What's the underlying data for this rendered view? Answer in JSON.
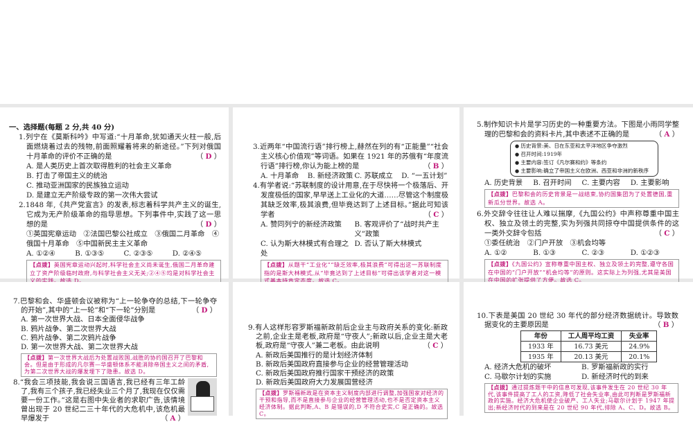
{
  "section_heading": "一、选择题(每题 2 分,共 40 分)",
  "panels": [
    {
      "questions": [
        {
          "num": "1.",
          "stem": "列宁在《莫斯科吟》中写道:“十月革命,犹如通天火柱一般,后面燃烧着过去的残物,前面照耀着将来的新途径。”下列对俄国十月革命的评价不正确的是",
          "answer": "D",
          "options": [
            "A. 是人类历史上首次取得胜利的社会主义革命",
            "B. 打击了帝国主义的统治",
            "C. 推动亚洲国家的民族独立运动",
            "D. 是建立无产阶级专政的第一次伟大尝试"
          ]
        },
        {
          "num": "2.",
          "stem": "1848 年,《共产党宣言》的发表,标志着科学共产主义的诞生,它成为无产阶级革命的指导思想。下列事件中,实践了这一思想的是",
          "answer": "D",
          "extra": "①英国宪章运动　②法国巴黎公社成立　③俄国二月革命　④俄国十月革命　⑤中国新民主主义革命",
          "options": [
            "A. ①②④",
            "B. ①③⑤",
            "C. ②③⑤",
            "D. ②④⑤"
          ],
          "note_label": "【点拨】",
          "note": "英国宪章运动兴起时,科学社会主义尚未诞生,俄国二月革命建立了资产阶级临时政府,与科学社会主义无关;②④⑤均是对科学社会主义的实践。故选 D。"
        }
      ]
    },
    {
      "questions": [
        {
          "num": "3.",
          "stem": "近两年“中国流行语”排行榜上,赫然在列的有“正能量”“社会主义核心价值观”等词语。如果在 1921 年的苏俄有“年度流行语”排行榜,你认为能上榜的是",
          "answer": "B",
          "options": [
            "A. 十月革命",
            "B. 新经济政策",
            "C. 苏联成立",
            "D. “一五计划”"
          ]
        },
        {
          "num": "4.",
          "stem": "有学者说:“苏联制度的设计用意,在于尽快将一个极落后、开发度极低的国家,早早送上工业化的大道……尽管这个制度极其缺乏效率,极其浪费,但毕竟达到了上述目标。”据此可知该学者",
          "answer": "C",
          "options": [
            "A. 赞同列宁的新经济政策",
            "B. 客观评价了“战时共产主义”政策",
            "C. 认为斯大林模式有合理之处",
            "D. 否认了斯大林模式"
          ],
          "note_label": "【点拨】",
          "note": "从题干“工业化”“缺乏效率,极其浪费”可得出这一苏联制度指的是斯大林模式,从“毕竟达到了上述目标”可得出该学者对这一模式基本持肯定态度。故选 C。"
        }
      ]
    },
    {
      "questions": [
        {
          "num": "5.",
          "stem": "制作知识卡片是学习历史的一种重要方法。下图是小雨同学整理的巴黎和会的资料卡片,其中表述不正确的是",
          "answer": "A",
          "card": [
            "历史背景:美、日在东亚和太平洋地区争夺激烈",
            "召开时间:1919年",
            "主要内容:签订《凡尔赛和约》等条约",
            "主要影响:确立了帝国主义在欧洲、西亚和非洲的新秩序"
          ],
          "options": [
            "A. 历史背景",
            "B. 召开时间",
            "C. 主要内容",
            "D. 主要影响"
          ],
          "note_label": "【点拨】",
          "note": "巴黎和会的历史背景是一战结束,协约国集团为了处置德国,重新瓜分世界。故选 A。"
        },
        {
          "num": "6.",
          "stem": "外交辞令往往让人难以揣摩,《九国公约》中声称尊重中国主权、独立及领土的完整,实为列强共同掠夺中国提供条件的这一类外交辞令包括",
          "answer": "C",
          "extra": "①委任统治　②门户开放　③机会均等",
          "options": [
            "A. ①②",
            "B. ①③",
            "C. ②③",
            "D. ①②③"
          ],
          "note_label": "【点拨】",
          "note": "《九国公约》宣称尊重中国主权、独立及领土的完整,遵守各国在中国的“门户开放”“机会均等”的原则。这实际上为列强,尤其是美国在中国的扩张提供了方便。故选 C。"
        }
      ]
    },
    {
      "questions": [
        {
          "num": "7.",
          "stem": "巴黎和会、华盛顿会议被称为“上一轮争夺的总结,下一轮争夺的开始”,其中的“上一轮”和“下一轮”分别是",
          "answer": "D",
          "options": [
            "A. 第一次世界大战、日本全面侵华战争",
            "B. 鸦片战争、第二次世界大战",
            "C. 鸦片战争、第二次鸦片战争",
            "D. 第一次世界大战、第二次世界大战"
          ],
          "note_label": "【点拨】",
          "note": "第一次世界大战后为处置战败国,战胜的协约国召开了巴黎和会。但是由于形成的凡尔赛—华盛顿体系不能消除帝国主义之间的矛盾,为第二次世界大战的爆发埋下了隐患。故选 D。"
        },
        {
          "num": "8.",
          "stem": "“我会三项技能,我会说三国语言,我已经有三年工龄了,我有三个孩子,我已经失业三个月了,我现在仅仅需要一份工作。”这是右图中失业者的求职广告,该情境曾出现于 20 世纪二三十年代的大危机中,该危机最早爆发于",
          "answer": "A",
          "options": []
        }
      ]
    },
    {
      "questions": [
        {
          "num": "9.",
          "stem": "有人这样形容罗斯福新政前后企业主与政府关系的变化:新政之前,企业主是老板,政府是“守夜人”;新政以后,企业主是大老板,政府是“守夜人”兼二老板。由此说明",
          "answer": "C",
          "options": [
            "A. 新政后美国推行的是计划经济体制",
            "B. 新政后美国政府直接参与企业的经营管理活动",
            "C. 新政后美国政府推行国家干预经济的政策",
            "D. 新政后美国政府大力发展国营经济"
          ],
          "note_label": "【点拨】",
          "note": "罗斯福新政是在资本主义制度内部进行调整,加强国家对经济的干预和指导,而不是直接参与企业的经营管理活动,也不是否定资本主义经济体制。据此判断,A、B 是错误的,D 不符合史实,C 是正确的。故选 C。"
        }
      ]
    },
    {
      "questions": [
        {
          "num": "10.",
          "stem": "下表是美国 20 世纪 30 年代的部分经济数据统计。导致数据变化的主要原因是",
          "answer": "B",
          "table": {
            "headers": [
              "年份",
              "工人周平均工资",
              "失业率"
            ],
            "rows": [
              [
                "1933 年",
                "16.73 美元",
                "24.9%"
              ],
              [
                "1935 年",
                "20.13 美元",
                "20.1%"
              ]
            ]
          },
          "options": [
            "A. 经济大危机的破坏",
            "B. 罗斯福新政的实行",
            "C. 马歇尔计划的实施",
            "D. 新经济时代的到来"
          ],
          "note_label": "【点拨】",
          "note": "通过提炼题干中的信息可发现,该事件发生在 20 世纪 30 年代,该事件提高了工人的工资,降低了社会失业率,由此可判断是罗斯福新政的实施。经济大危机使企业破产、工人失业;马歇尔计划于 1947 年提出;新经济时代的到来是在 20 世纪 90 年代,排除 A、C、D。故选 B。"
        }
      ]
    }
  ],
  "colors": {
    "answer": "#c2187a",
    "gap": "#e8e8e8"
  }
}
